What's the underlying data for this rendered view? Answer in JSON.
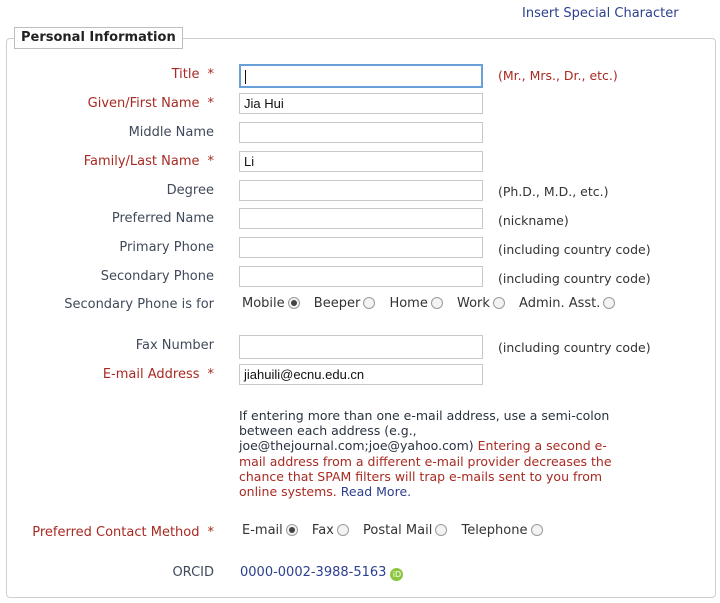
{
  "top_link": "Insert Special Character",
  "section_title": "Personal Information",
  "fields": {
    "title": {
      "label": "Title",
      "required_mark": "*",
      "value": "",
      "hint": "(Mr., Mrs., Dr., etc.)"
    },
    "given_name": {
      "label": "Given/First Name",
      "required_mark": "*",
      "value": "Jia Hui"
    },
    "middle_name": {
      "label": "Middle Name",
      "value": ""
    },
    "family_name": {
      "label": "Family/Last Name",
      "required_mark": "*",
      "value": "Li"
    },
    "degree": {
      "label": "Degree",
      "value": "",
      "hint": "(Ph.D., M.D., etc.)"
    },
    "preferred_name": {
      "label": "Preferred Name",
      "value": "",
      "hint": "(nickname)"
    },
    "primary_phone": {
      "label": "Primary Phone",
      "value": "",
      "hint": "(including country code)"
    },
    "secondary_phone": {
      "label": "Secondary Phone",
      "value": "",
      "hint": "(including country code)"
    },
    "fax": {
      "label": "Fax Number",
      "value": "",
      "hint": "(including country code)"
    },
    "email": {
      "label": "E-mail Address",
      "required_mark": "*",
      "value": "jiahuili@ecnu.edu.cn"
    }
  },
  "secondary_phone_for": {
    "label": "Secondary Phone is for",
    "options": [
      "Mobile",
      "Beeper",
      "Home",
      "Work",
      "Admin. Asst."
    ],
    "selected": "Mobile"
  },
  "email_note": {
    "text": "If entering more than one e-mail address, use a semi-colon between each address (e.g., joe@thejournal.com;joe@yahoo.com)",
    "warning": "Entering a second e-mail address from a different e-mail provider decreases the chance that SPAM filters will trap e-mails sent to you from online systems.",
    "link": "Read More."
  },
  "preferred_contact": {
    "label": "Preferred Contact Method",
    "required_mark": "*",
    "options": [
      "E-mail",
      "Fax",
      "Postal Mail",
      "Telephone"
    ],
    "selected": "E-mail"
  },
  "orcid": {
    "label": "ORCID",
    "value": "0000-0002-3988-5163",
    "icon": "orcid-icon"
  },
  "colors": {
    "required_label": "#a82a22",
    "label": "#404a5a",
    "link": "#2d3f8f",
    "orcid_green": "#8cc63f"
  }
}
